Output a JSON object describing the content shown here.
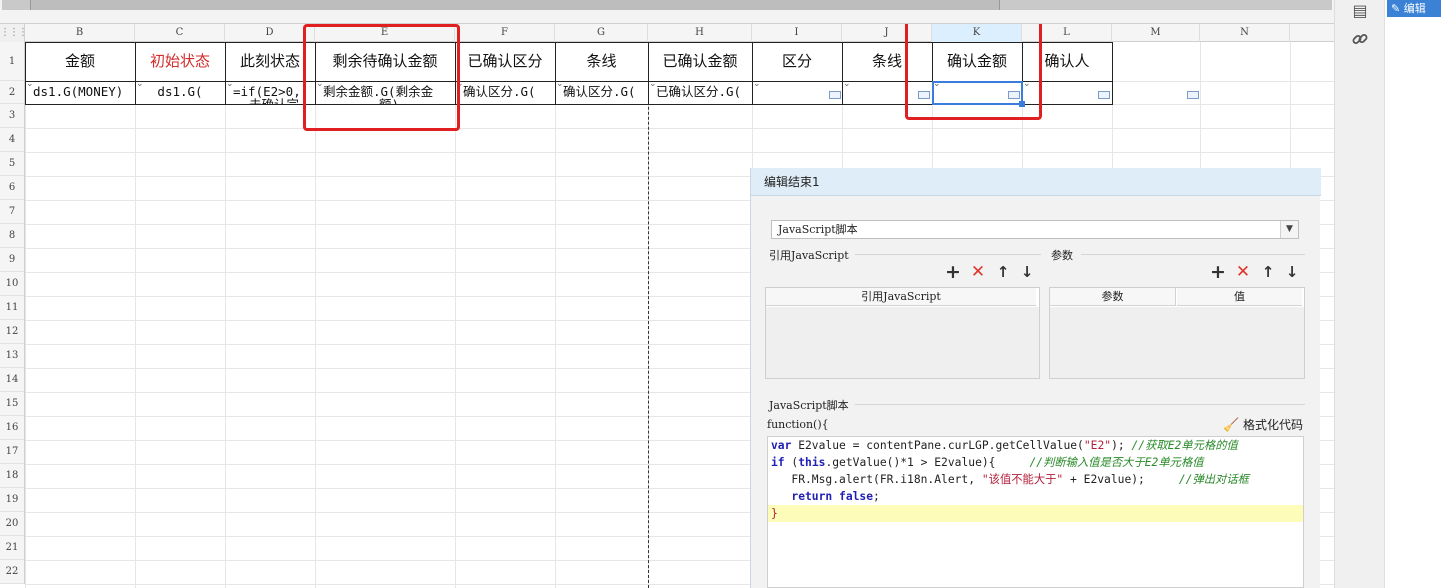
{
  "columns": [
    "B",
    "C",
    "D",
    "E",
    "F",
    "G",
    "H",
    "I",
    "J",
    "K",
    "L",
    "M",
    "N"
  ],
  "rows": [
    "1",
    "2",
    "3",
    "4",
    "5",
    "6",
    "7",
    "8",
    "9",
    "10",
    "11",
    "12",
    "13",
    "14",
    "15",
    "16",
    "17",
    "18",
    "19",
    "20",
    "21",
    "22"
  ],
  "row1": [
    "金额",
    "初始状态",
    "此刻状态",
    "剩余待确认金额",
    "已确认区分",
    "条线",
    "已确认金额",
    "区分",
    "条线",
    "确认金额",
    "确认人"
  ],
  "row2": [
    "ds1.G(MONEY)",
    "ds1.G(",
    "=if(E2>0,",
    "剩余金额.G(剩余金",
    "确认区分.G(",
    "确认区分.G(",
    "已确认区分.G(",
    "",
    "",
    "",
    ""
  ],
  "row2_overflow": {
    "D": "未确认完",
    "E": "额)"
  },
  "dialog": {
    "title": "编辑结束1",
    "script_type": "JavaScript脚本",
    "ref_label": "引用JavaScript",
    "params_label": "参数",
    "ref_col": "引用JavaScript",
    "param_col": "参数",
    "value_col": "值",
    "script_label": "JavaScript脚本",
    "format_label": "格式化代码",
    "function_sig": "function(){"
  },
  "code": [
    {
      "parts": [
        [
          "kw",
          "var"
        ],
        [
          "pl",
          " E2value = contentPane.curLGP.getCellValue("
        ],
        [
          "str",
          "\"E2\""
        ],
        [
          "pl",
          "); "
        ],
        [
          "cm",
          "//获取E2单元格的值"
        ]
      ]
    },
    {
      "parts": [
        [
          "kw",
          "if"
        ],
        [
          "pl",
          " ("
        ],
        [
          "kw",
          "this"
        ],
        [
          "pl",
          ".getValue()*1 > E2value){     "
        ],
        [
          "cm",
          "//判断输入值是否大于E2单元格值"
        ]
      ]
    },
    {
      "parts": [
        [
          "pl",
          "   FR.Msg.alert(FR.i18n.Alert, "
        ],
        [
          "str",
          "\"该值不能大于\""
        ],
        [
          "pl",
          " + E2value);     "
        ],
        [
          "cm",
          "//弹出对话框"
        ]
      ]
    },
    {
      "parts": [
        [
          "pl",
          "   "
        ],
        [
          "kw",
          "return"
        ],
        [
          "pl",
          " "
        ],
        [
          "kw",
          "false"
        ],
        [
          "pl",
          ";"
        ]
      ]
    },
    {
      "parts": [
        [
          "str",
          "}"
        ]
      ],
      "highlight": true
    }
  ],
  "toolbar": {
    "edit_tab": "编辑"
  },
  "icons": {
    "top": "panel-icon",
    "link": "link-icon",
    "edit": "pencil-icon",
    "broom": "broom-icon"
  }
}
